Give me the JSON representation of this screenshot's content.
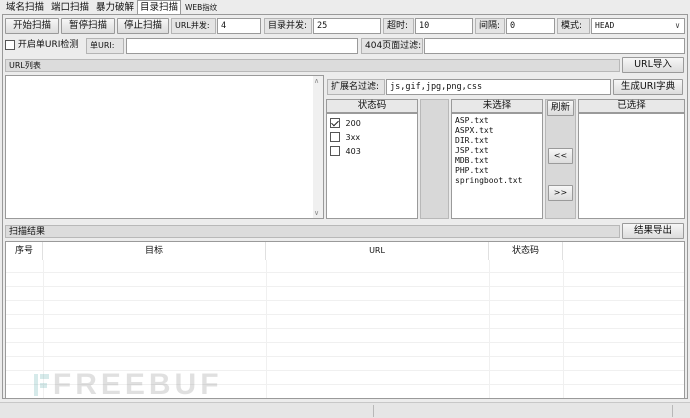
{
  "tabs": [
    "域名扫描",
    "端口扫描",
    "暴力破解",
    "目录扫描",
    "WEB指纹"
  ],
  "toolbar": {
    "start": "开始扫描",
    "pause": "暂停扫描",
    "stop": "停止扫描",
    "url_concurrency_label": "URL并发:",
    "url_concurrency_value": "4",
    "dir_concurrency_label": "目录并发:",
    "dir_concurrency_value": "25",
    "timeout_label": "超时:",
    "timeout_value": "10",
    "interval_label": "间隔:",
    "interval_value": "0",
    "mode_label": "模式:",
    "mode_value": "HEAD"
  },
  "row2": {
    "single_url_check": "开启单URI检测",
    "single_url_label": "单URI:",
    "single_url_value": "",
    "page_filter_label": "404页面过滤:",
    "page_filter_value": ""
  },
  "url_list": {
    "title": "URL列表",
    "import": "URL导入"
  },
  "ext_filter": {
    "label": "扩展名过滤:",
    "value": "js,gif,jpg,png,css",
    "gen_dict": "生成URI字典"
  },
  "status_codes": {
    "header": "状态码",
    "items": [
      {
        "label": "200",
        "checked": true
      },
      {
        "label": "3xx",
        "checked": false
      },
      {
        "label": "403",
        "checked": false
      }
    ]
  },
  "unselected": {
    "header": "未选择",
    "items": [
      "ASP.txt",
      "ASPX.txt",
      "DIR.txt",
      "JSP.txt",
      "MDB.txt",
      "PHP.txt",
      "springboot.txt"
    ]
  },
  "refresh": "刷新",
  "move_left": "<<",
  "move_right": ">>",
  "selected": {
    "header": "已选择",
    "items": []
  },
  "results": {
    "title": "扫描结果",
    "export": "结果导出",
    "columns": [
      "序号",
      "目标",
      "URL",
      "状态码"
    ]
  },
  "watermark": "FREEBUF"
}
